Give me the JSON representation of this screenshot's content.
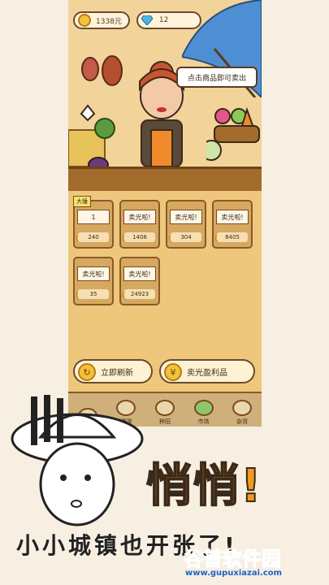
{
  "status": {
    "coins": "1338元",
    "gems": "12"
  },
  "speech": "点击商品即可卖出",
  "shelf": {
    "tag": "大锤",
    "slots": [
      {
        "banner": "1",
        "price": "240"
      },
      {
        "banner": "卖光啦!",
        "price": "1406"
      },
      {
        "banner": "卖光啦!",
        "price": "304"
      },
      {
        "banner": "卖光啦!",
        "price": "8405"
      },
      {
        "banner": "卖光啦!",
        "price": "35"
      },
      {
        "banner": "卖光啦!",
        "price": "24923"
      }
    ]
  },
  "actions": {
    "refresh_label": "立即刷新",
    "sell_label": "卖光盈利品"
  },
  "nav": [
    {
      "label": "",
      "icon": "shop-icon"
    },
    {
      "label": "漫游",
      "icon": "wander-icon"
    },
    {
      "label": "种田",
      "icon": "sprout-icon"
    },
    {
      "label": "市场",
      "icon": "market-icon"
    },
    {
      "label": "杂货",
      "icon": "grocery-icon"
    }
  ],
  "promo": {
    "headline": "悄悄!",
    "subline": "小小城镇也开张了!"
  },
  "watermark": {
    "title": "谷普软件园",
    "url": "www.gupuxiazai.com"
  },
  "colors": {
    "headline": "#f19a1d",
    "wood": "#a36b2b",
    "watermark": "#1e63c6"
  }
}
